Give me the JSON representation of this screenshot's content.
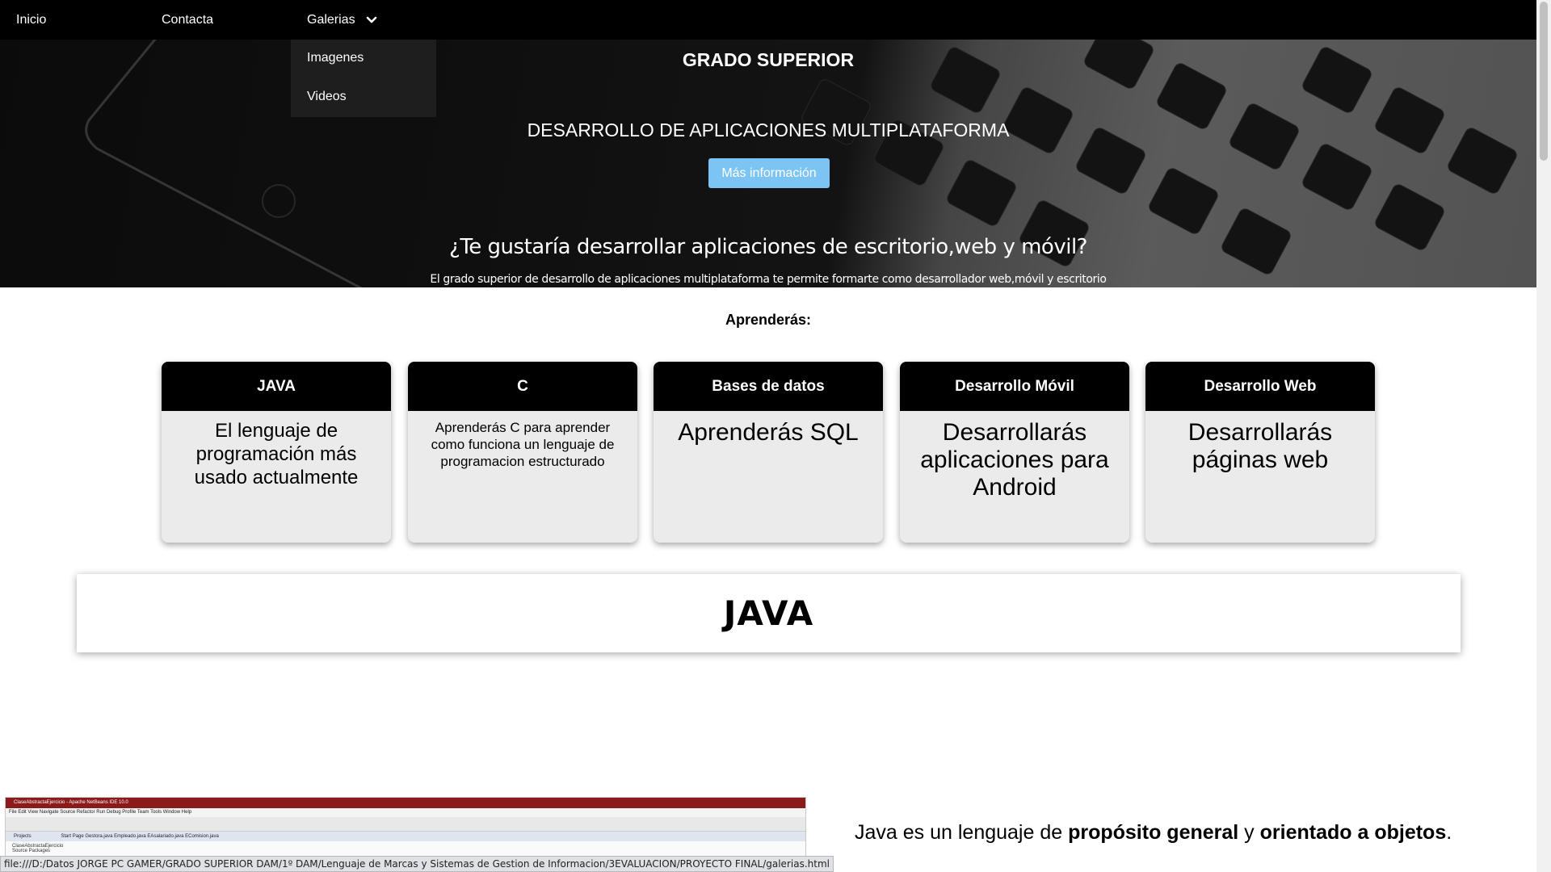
{
  "nav": {
    "items": [
      {
        "label": "Inicio"
      },
      {
        "label": "Contacta"
      },
      {
        "label": "Galerias"
      }
    ],
    "dropdown": [
      {
        "label": "Imagenes"
      },
      {
        "label": "Videos"
      }
    ]
  },
  "hero": {
    "title": "GRADO SUPERIOR",
    "subtitle": "DESARROLLO DE APLICACIONES MULTIPLATAFORMA",
    "button_label": "Más información",
    "question": "¿Te gustaría desarrollar aplicaciones de escritorio,web y móvil?",
    "description": "El grado superior de desarrollo de aplicaciones multiplataforma te permite formarte como desarrollador web,móvil y escritorio"
  },
  "learn": {
    "title": "Aprenderás:",
    "cards": [
      {
        "title": "JAVA",
        "body": "El lenguaje de programación más usado actualmente"
      },
      {
        "title": "C",
        "body": "Aprenderás C para aprender como funciona un lenguaje de programacion estructurado"
      },
      {
        "title": "Bases de datos",
        "body": "Aprenderás SQL"
      },
      {
        "title": "Desarrollo Móvil",
        "body": "Desarrollarás aplicaciones para Android"
      },
      {
        "title": "Desarrollo Web",
        "body": "Desarrollarás páginas web"
      }
    ]
  },
  "java_section": {
    "heading": "JAVA",
    "desc_part1": "Java es un lenguaje de ",
    "desc_bold1": "propósito general",
    "desc_part2": " y ",
    "desc_bold2": "orientado a objetos",
    "desc_part3": "."
  },
  "thumbnail": {
    "window_title": "ClaseAbstractaEjercicio - Apache NetBeans IDE 10.0",
    "menu": "File   Edit   View   Navigate   Source   Refactor   Run   Debug   Profile   Team   Tools   Window   Help",
    "tabs": "Start Page   Gestora.java   Empleado.java   EAsalariado.java   EComision.java",
    "projects_label": "Projects",
    "project_item": "ClaseAbstractaEjercicio",
    "source_label": "Source Packages"
  },
  "status_bar": {
    "url": "file:///D:/Datos JORGE PC GAMER/GRADO SUPERIOR DAM/1º DAM/Lenguaje de Marcas y Sistemas de Gestion de Informacion/3EVALUACION/PROYECTO FINAL/galerias.html"
  },
  "colors": {
    "nav_bg": "#000000",
    "button_bg": "#7cc4f4",
    "card_bg": "#ebebeb",
    "card_head_bg": "#000000"
  }
}
